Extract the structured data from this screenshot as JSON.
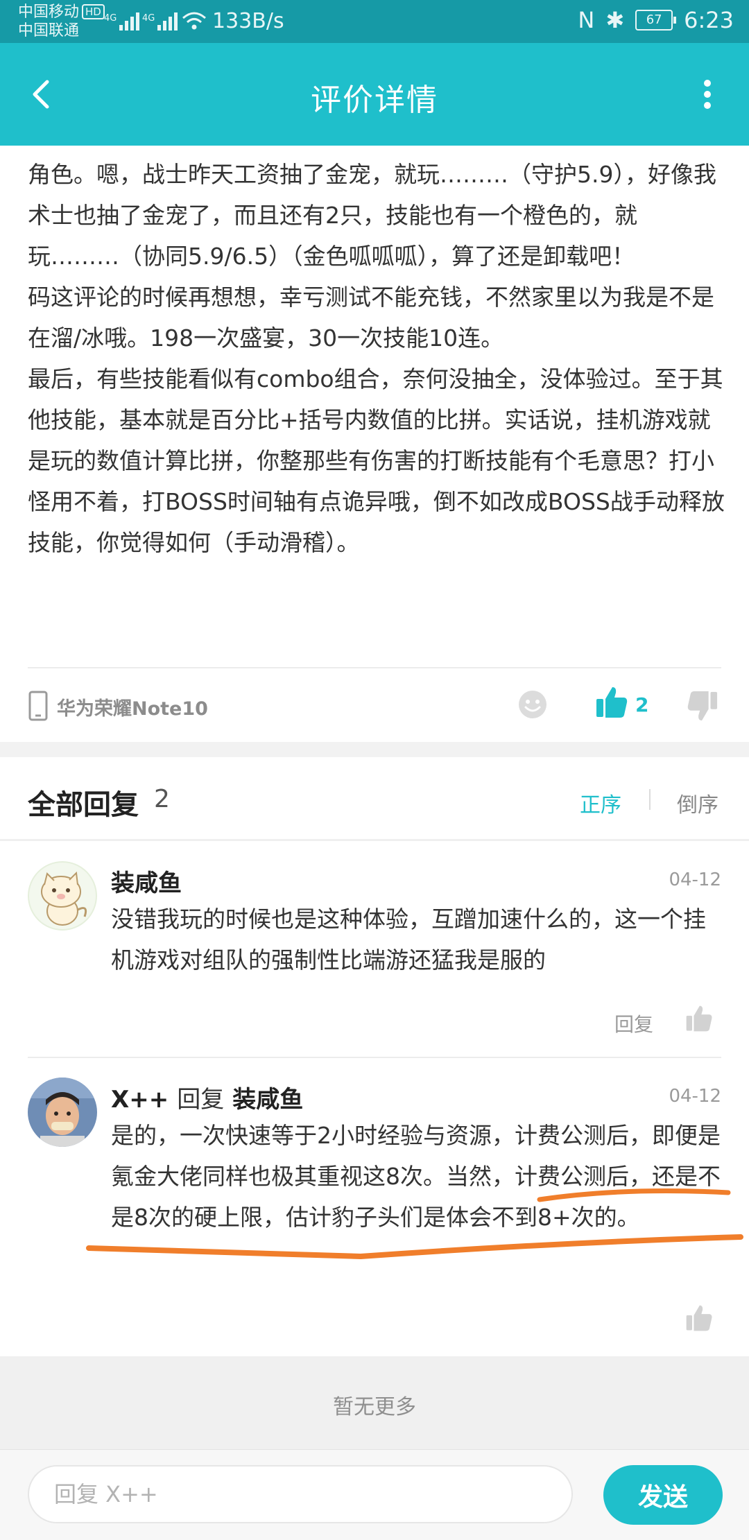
{
  "status_bar": {
    "carrier_1": "中国移动",
    "hd_badge": "HD",
    "carrier_2": "中国联通",
    "net_speed": "133B/s",
    "nfc_label": "N",
    "bluetooth_label": "✱",
    "battery": "67",
    "time": "6:23"
  },
  "app_bar": {
    "title": "评价详情"
  },
  "review": {
    "text": "角色。嗯，战士昨天工资抽了金宠，就玩………（守护5.9），好像我术士也抽了金宠了，而且还有2只，技能也有一个橙色的，就玩………（协同5.9/6.5）（金色呱呱呱），算了还是卸载吧！\n码这评论的时候再想想，幸亏测试不能充钱，不然家里以为我是不是在溜/冰哦。198一次盛宴，30一次技能10连。\n最后，有些技能看似有combo组合，奈何没抽全，没体验过。至于其他技能，基本就是百分比+括号内数值的比拼。实话说，挂机游戏就是玩的数值计算比拼，你整那些有伤害的打断技能有个毛意思？打小怪用不着，打BOSS时间轴有点诡异哦，倒不如改成BOSS战手动释放技能，你觉得如何（手动滑稽）。",
    "device": "华为荣耀Note10",
    "like_count": "2"
  },
  "replies_section": {
    "title": "全部回复",
    "count": "2",
    "sort_asc": "正序",
    "sort_desc": "倒序"
  },
  "replies": [
    {
      "author": "装咸鱼",
      "date": "04-12",
      "text": "没错我玩的时候也是这种体验，互蹭加速什么的，这一个挂机游戏对组队的强制性比端游还猛我是服的",
      "reply_label": "回复"
    },
    {
      "author": "X++",
      "reply_word": "回复",
      "reply_to": "装咸鱼",
      "date": "04-12",
      "text": "是的，一次快速等于2小时经验与资源，计费公测后，即便是氪金大佬同样也极其重视这8次。当然，计费公测后，还是不是8次的硬上限，估计豹子头们是体会不到8+次的。"
    }
  ],
  "footer": {
    "no_more": "暂无更多",
    "input_placeholder": "回复 X++",
    "send_label": "发送"
  },
  "colors": {
    "primary": "#1fbfcb",
    "status_bar": "#169aa6",
    "annotation": "#f07e2b"
  }
}
